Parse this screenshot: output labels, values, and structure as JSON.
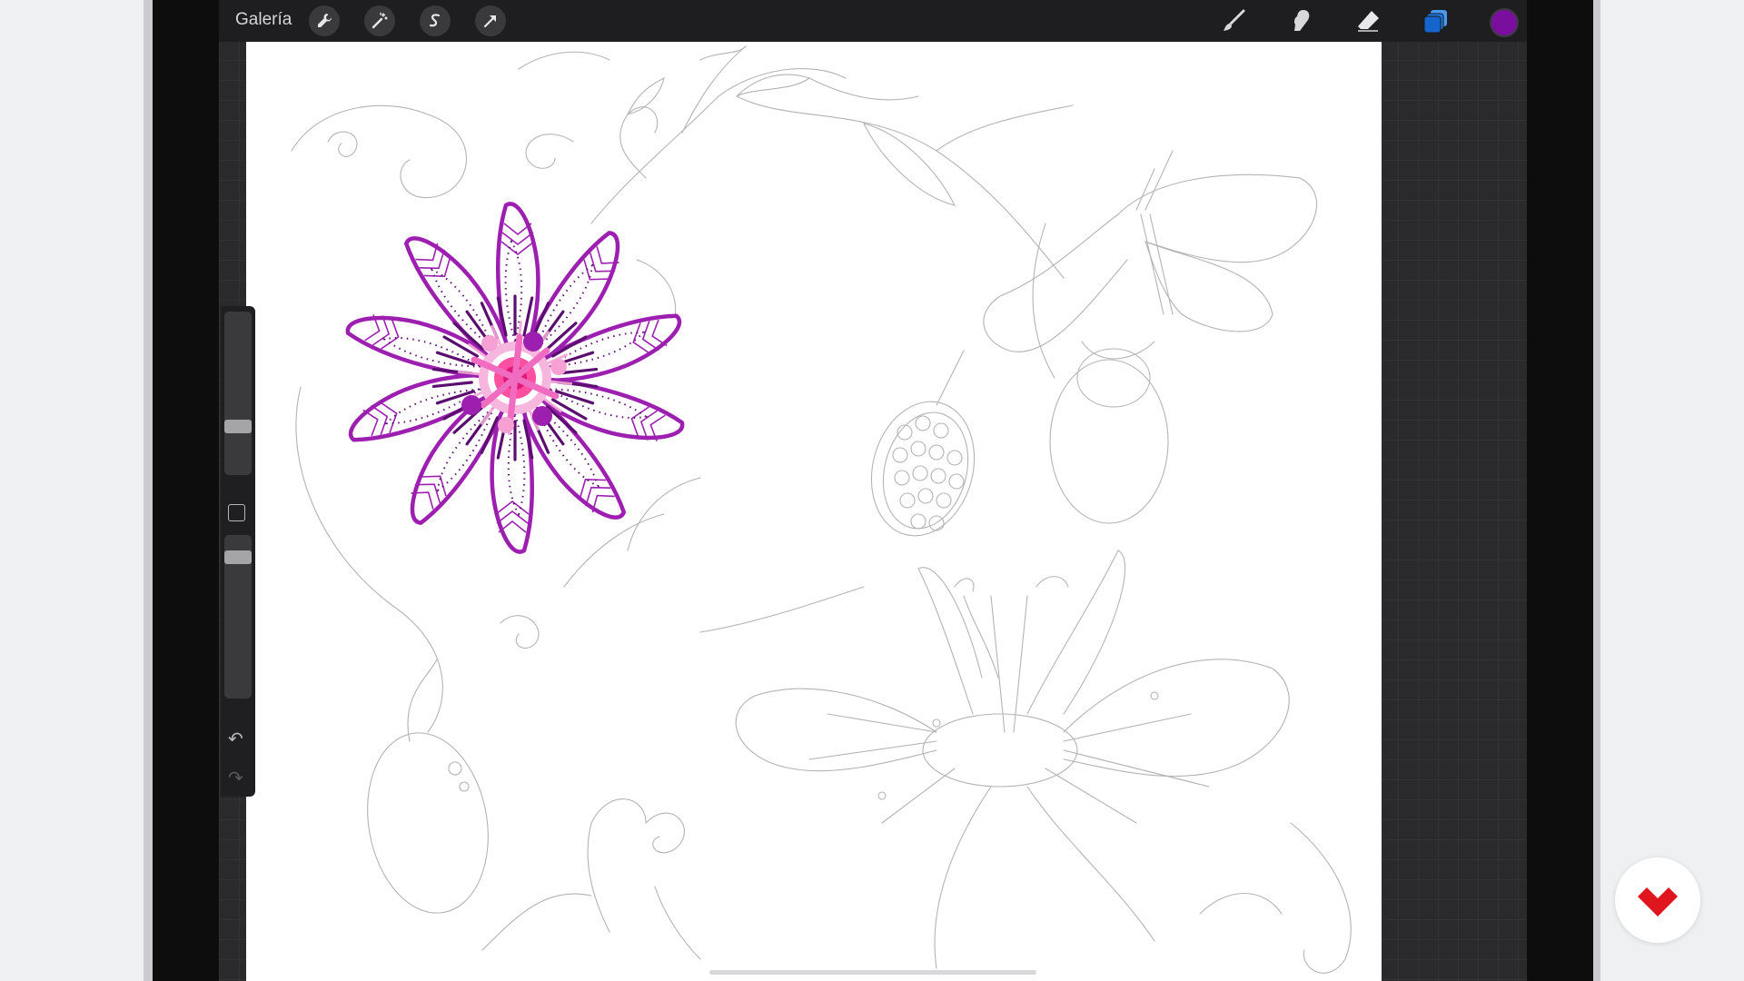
{
  "topbar": {
    "gallery_label": "Galería",
    "left_tools": [
      "wrench-icon",
      "magic-wand-icon",
      "selection-icon",
      "transform-icon"
    ],
    "right_tools": [
      "brush-icon",
      "smudge-icon",
      "eraser-icon",
      "layers-icon"
    ],
    "current_color": "#7a0e9e",
    "layers_color": "#1f7ae0"
  },
  "sidebar": {
    "icons": [
      "brush-size-slider",
      "modify-button",
      "opacity-slider",
      "undo-icon",
      "redo-icon"
    ]
  },
  "canvas": {
    "background": "#ffffff",
    "accent_colors": [
      "#9c1fb0",
      "#ff4fa0",
      "#5a0f6e"
    ]
  },
  "brand": {
    "logo_color": "#e0161e"
  }
}
